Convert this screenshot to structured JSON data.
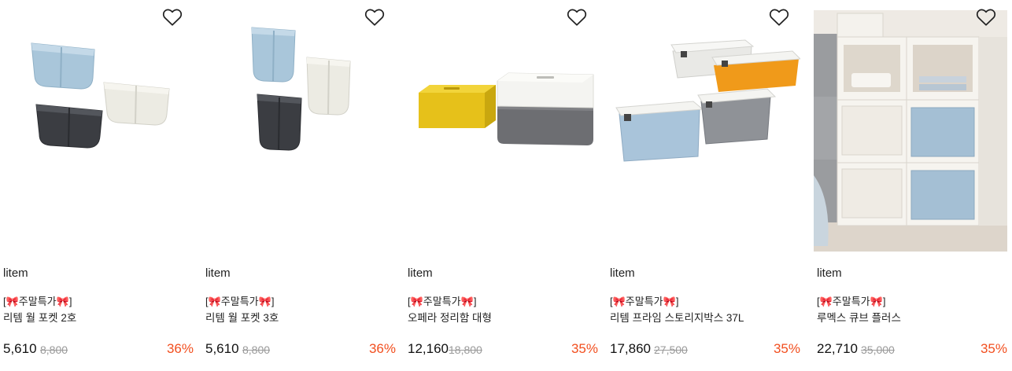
{
  "products": [
    {
      "brand": "litem",
      "promo": "[🎀주말특가🎀]",
      "title": "리템 월 포켓 2호",
      "price": "5,610",
      "original_price": "8,800",
      "discount": "36%",
      "image": "wall-pocket-2-icon"
    },
    {
      "brand": "litem",
      "promo": "[🎀주말특가🎀]",
      "title": "리템 월 포켓 3호",
      "price": "5,610",
      "original_price": "8,800",
      "discount": "36%",
      "image": "wall-pocket-3-icon"
    },
    {
      "brand": "litem",
      "promo": "[🎀주말특가🎀]",
      "title": "오페라 정리함 대형",
      "price": "12,160",
      "original_price": "18,800",
      "discount": "35%",
      "image": "storage-box-icon"
    },
    {
      "brand": "litem",
      "promo": "[🎀주말특가🎀]",
      "title": "리템 프라임 스토리지박스 37L",
      "price": "17,860",
      "original_price": "27,500",
      "discount": "35%",
      "image": "prime-storage-icon"
    },
    {
      "brand": "litem",
      "promo": "[🎀주말특가🎀]",
      "title": "루멕스 큐브 플러스",
      "price": "22,710",
      "original_price": "35,000",
      "discount": "35%",
      "image": "cube-shelf-icon"
    }
  ],
  "colors": {
    "discount": "#f24f1f",
    "original_price": "#9a9a9a",
    "text": "#222222"
  }
}
